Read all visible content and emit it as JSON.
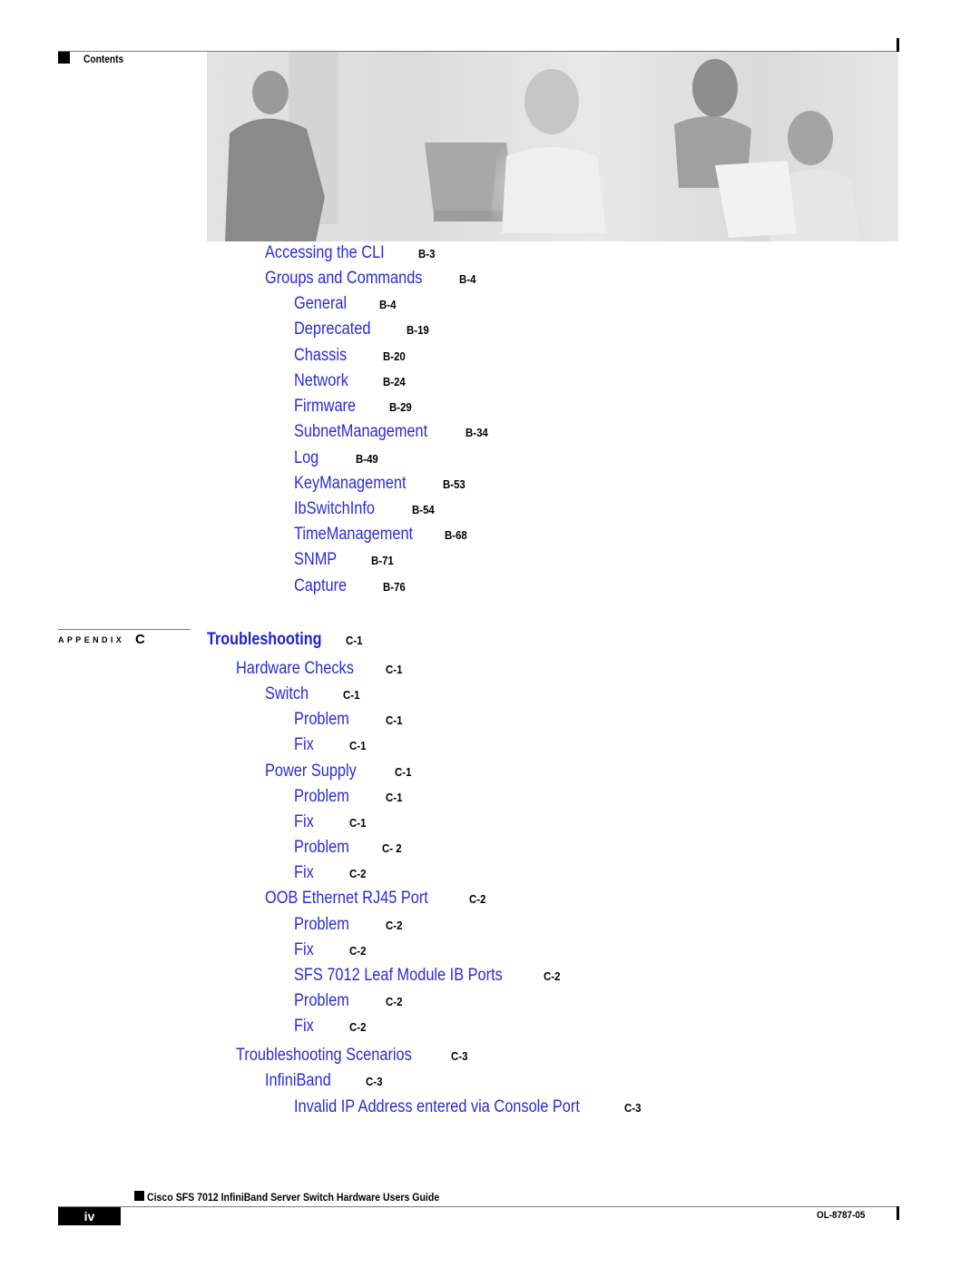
{
  "header": {
    "section_label": "Contents"
  },
  "banner_image": {
    "description": "Grayscale photo of four people working with networking equipment and a laptop"
  },
  "toc_pre": [
    {
      "title": "Accessing the CLI",
      "page": "B-3",
      "level": 1
    },
    {
      "title": "Groups and Commands",
      "page": "B-4",
      "level": 1
    },
    {
      "title": "General",
      "page": "B-4",
      "level": 2
    },
    {
      "title": "Deprecated",
      "page": "B-19",
      "level": 2
    },
    {
      "title": "Chassis",
      "page": "B-20",
      "level": 2
    },
    {
      "title": "Network",
      "page": "B-24",
      "level": 2
    },
    {
      "title": "Firmware",
      "page": "B-29",
      "level": 2
    },
    {
      "title": "SubnetManagement",
      "page": "B-34",
      "level": 2
    },
    {
      "title": "Log",
      "page": "B-49",
      "level": 2
    },
    {
      "title": "KeyManagement",
      "page": "B-53",
      "level": 2
    },
    {
      "title": "IbSwitchInfo",
      "page": "B-54",
      "level": 2
    },
    {
      "title": "TimeManagement",
      "page": "B-68",
      "level": 2
    },
    {
      "title": "SNMP",
      "page": "B-71",
      "level": 2
    },
    {
      "title": "Capture",
      "page": "B-76",
      "level": 2
    }
  ],
  "appendix": {
    "label": "APPENDIX",
    "letter": "C",
    "title": "Troubleshooting",
    "page": "C-1"
  },
  "toc_appendix": [
    {
      "title": "Hardware Checks",
      "page": "C-1",
      "level": 0
    },
    {
      "title": "Switch",
      "page": "C-1",
      "level": 1
    },
    {
      "title": "Problem",
      "page": "C-1",
      "level": 2
    },
    {
      "title": "Fix",
      "page": "C-1",
      "level": 2
    },
    {
      "title": "Power Supply",
      "page": "C-1",
      "level": 1
    },
    {
      "title": "Problem",
      "page": "C-1",
      "level": 2
    },
    {
      "title": "Fix",
      "page": "C-1",
      "level": 2
    },
    {
      "title": "Problem",
      "page": "C- 2",
      "level": 2
    },
    {
      "title": "Fix",
      "page": "C-2",
      "level": 2
    },
    {
      "title": "OOB Ethernet RJ45 Port",
      "page": "C-2",
      "level": 1
    },
    {
      "title": "Problem",
      "page": "C-2",
      "level": 2
    },
    {
      "title": "Fix",
      "page": "C-2",
      "level": 2
    },
    {
      "title": "SFS 7012 Leaf Module IB Ports",
      "page": "C-2",
      "level": 2
    },
    {
      "title": "Problem",
      "page": "C-2",
      "level": 2
    },
    {
      "title": "Fix",
      "page": "C-2",
      "level": 2
    },
    {
      "title": "Troubleshooting Scenarios",
      "page": "C-3",
      "level": 0
    },
    {
      "title": "InfiniBand",
      "page": "C-3",
      "level": 1
    },
    {
      "title": "Invalid IP Address entered via Console Port",
      "page": "C-3",
      "level": 2
    }
  ],
  "footer": {
    "guide_title": "Cisco SFS 7012 InfiniBand Server Switch Hardware Users Guide",
    "page_number": "iv",
    "doc_number": "OL-8787-05"
  },
  "colors": {
    "link": "#2b2bd9",
    "chapter_link": "#1f1fd6",
    "text": "#000000"
  }
}
